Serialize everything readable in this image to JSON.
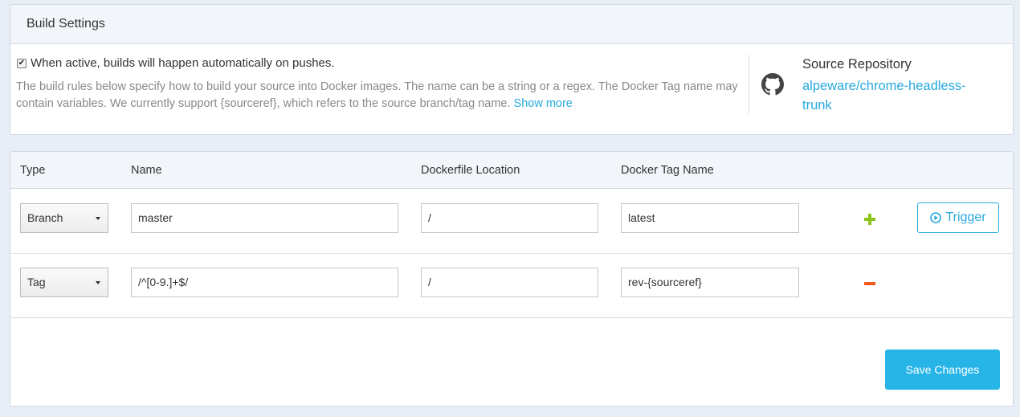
{
  "build_settings": {
    "title": "Build Settings",
    "autobuild_checked": true,
    "autobuild_label": "When active, builds will happen automatically on pushes.",
    "help_text": "The build rules below specify how to build your source into Docker images. The name can be a string or a regex. The Docker Tag name may contain variables. We currently support {sourceref}, which refers to the source branch/tag name.",
    "show_more": "Show more",
    "source_repo_label": "Source Repository",
    "source_repo_link": "alpeware/chrome-headless-trunk",
    "source_icon": "github-icon"
  },
  "rules": {
    "headers": {
      "type": "Type",
      "name": "Name",
      "dockerfile": "Dockerfile Location",
      "tag": "Docker Tag Name"
    },
    "rows": [
      {
        "type": "Branch",
        "name": "master",
        "dockerfile": "/",
        "tag": "latest",
        "action_icon": "plus-icon",
        "trigger_label": "Trigger"
      },
      {
        "type": "Tag",
        "name": "/^[0-9.]+$/",
        "dockerfile": "/",
        "tag": "rev-{sourceref}",
        "action_icon": "minus-icon"
      }
    ],
    "save_label": "Save Changes"
  },
  "colors": {
    "accent": "#27a9de",
    "add": "#8cc41c",
    "remove": "#f05a1a"
  }
}
